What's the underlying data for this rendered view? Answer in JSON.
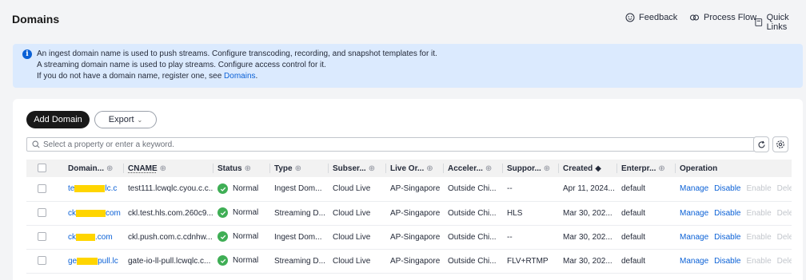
{
  "header": {
    "title": "Domains",
    "links": {
      "feedback": "Feedback",
      "process_flow": "Process Flow",
      "quick_links": "Quick Links"
    }
  },
  "notice": {
    "line1": "An ingest domain name is used to push streams. Configure transcoding, recording, and snapshot templates for it.",
    "line2": "A streaming domain name is used to play streams. Configure access control for it.",
    "line3_prefix": "If you do not have a domain name, register one, see ",
    "line3_link": "Domains",
    "line3_suffix": "."
  },
  "toolbar": {
    "add_label": "Add Domain",
    "export_label": "Export"
  },
  "search": {
    "placeholder": "Select a property or enter a keyword."
  },
  "table": {
    "columns": [
      "Domain...",
      "CNAME",
      "Status",
      "Type",
      "Subser...",
      "Live Or...",
      "Acceler...",
      "Suppor...",
      "Created",
      "Enterpr...",
      "Operation"
    ],
    "rows": [
      {
        "domain_start": "te",
        "domain_end": "lc.c",
        "cname": "test111.lcwqlc.cyou.c.c...",
        "status": "Normal",
        "type": "Ingest Dom...",
        "subservice": "Cloud Live",
        "region": "AP-Singapore",
        "acceleration": "Outside Chi...",
        "support": "--",
        "created": "Apr 11, 2024...",
        "enterprise": "default"
      },
      {
        "domain_start": "ck",
        "domain_end": "com",
        "cname": "ckl.test.hls.com.260c9...",
        "status": "Normal",
        "type": "Streaming D...",
        "subservice": "Cloud Live",
        "region": "AP-Singapore",
        "acceleration": "Outside Chi...",
        "support": "HLS",
        "created": "Mar 30, 202...",
        "enterprise": "default"
      },
      {
        "domain_start": "ck",
        "domain_end": ".com",
        "cname": "ckl.push.com.c.cdnhw....",
        "status": "Normal",
        "type": "Ingest Dom...",
        "subservice": "Cloud Live",
        "region": "AP-Singapore",
        "acceleration": "Outside Chi...",
        "support": "--",
        "created": "Mar 30, 202...",
        "enterprise": "default"
      },
      {
        "domain_start": "ge",
        "domain_end": "pull.lc",
        "cname": "gate-io-ll-pull.lcwqlc.c...",
        "status": "Normal",
        "type": "Streaming D...",
        "subservice": "Cloud Live",
        "region": "AP-Singapore",
        "acceleration": "Outside Chi...",
        "support": "FLV+RTMP",
        "created": "Mar 30, 202...",
        "enterprise": "default"
      }
    ],
    "operations": {
      "manage": "Manage",
      "disable": "Disable",
      "enable": "Enable",
      "delete": "Delete"
    }
  },
  "colors": {
    "accent": "#0b61d6",
    "status_normal": "#3fae55",
    "notice_bg": "#dbeafe",
    "redaction": "#ffd500"
  },
  "icons": [
    "info-icon",
    "feedback-icon",
    "process-flow-icon",
    "quick-links-icon",
    "search-icon",
    "refresh-icon",
    "settings-icon",
    "filter-icon",
    "sort-icon",
    "check-icon",
    "chevron-down-icon"
  ]
}
